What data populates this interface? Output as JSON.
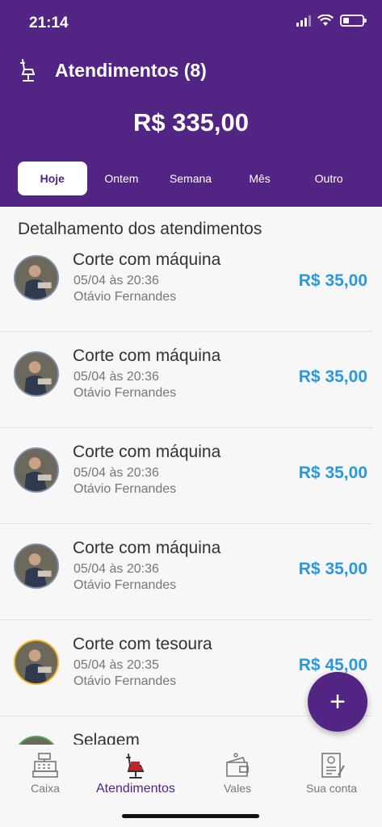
{
  "status_bar": {
    "time": "21:14"
  },
  "header": {
    "title": "Atendimentos (8)",
    "total": "R$ 335,00",
    "icon": "barber-chair-icon"
  },
  "tabs": [
    {
      "label": "Hoje",
      "active": true
    },
    {
      "label": "Ontem"
    },
    {
      "label": "Semana"
    },
    {
      "label": "Mês"
    },
    {
      "label": "Outro"
    }
  ],
  "section_title": "Detalhamento dos atendimentos",
  "appointments": [
    {
      "service": "Corte com máquina",
      "datetime": "05/04 às 20:36",
      "client": "Otávio Fernandes",
      "price": "R$ 35,00"
    },
    {
      "service": "Corte com máquina",
      "datetime": "05/04 às 20:36",
      "client": "Otávio Fernandes",
      "price": "R$ 35,00"
    },
    {
      "service": "Corte com máquina",
      "datetime": "05/04 às 20:36",
      "client": "Otávio Fernandes",
      "price": "R$ 35,00"
    },
    {
      "service": "Corte com máquina",
      "datetime": "05/04 às 20:36",
      "client": "Otávio Fernandes",
      "price": "R$ 35,00"
    },
    {
      "service": "Corte com tesoura",
      "datetime": "05/04 às 20:35",
      "client": "Otávio Fernandes",
      "price": "R$ 45,00"
    },
    {
      "service": "Selagem",
      "datetime": "",
      "client": "",
      "price": ""
    }
  ],
  "fab": {
    "label": "+"
  },
  "bottom_nav": [
    {
      "label": "Caixa",
      "icon": "cash-register-icon"
    },
    {
      "label": "Atendimentos",
      "icon": "barber-chair-icon",
      "active": true
    },
    {
      "label": "Vales",
      "icon": "wallet-icon"
    },
    {
      "label": "Sua conta",
      "icon": "account-document-icon"
    }
  ],
  "colors": {
    "primary": "#522483",
    "price": "#2a98e0",
    "background": "#f7f7f7"
  }
}
